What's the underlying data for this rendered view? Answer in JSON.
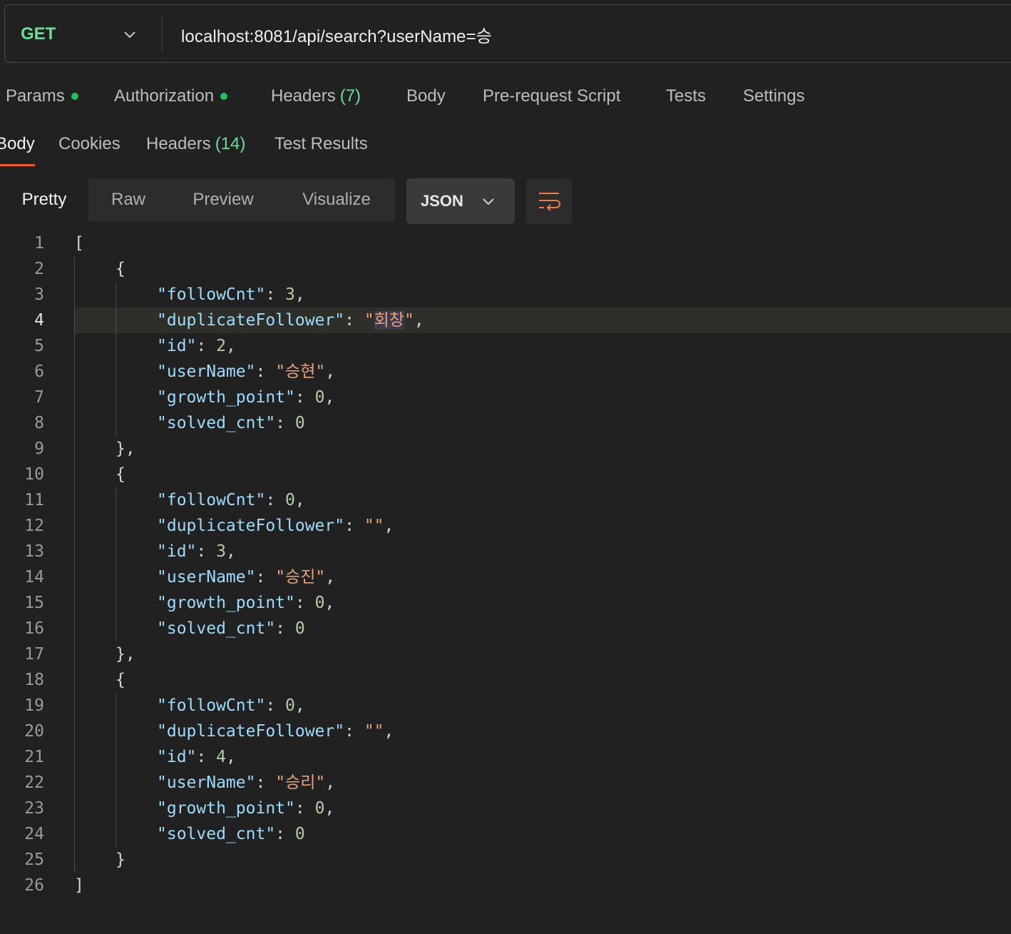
{
  "request": {
    "method": "GET",
    "url": "localhost:8081/api/search?userName=승"
  },
  "request_tabs": [
    {
      "label": "Params",
      "dot": true
    },
    {
      "label": "Authorization",
      "dot": true
    },
    {
      "label": "Headers",
      "count": "(7)"
    },
    {
      "label": "Body"
    },
    {
      "label": "Pre-request Script"
    },
    {
      "label": "Tests"
    },
    {
      "label": "Settings"
    }
  ],
  "response_tabs": [
    {
      "label": "Body",
      "count": ""
    },
    {
      "label": "Cookies",
      "count": ""
    },
    {
      "label": "Headers",
      "count": "(14)"
    },
    {
      "label": "Test Results",
      "count": ""
    }
  ],
  "active_response_tab": "Body",
  "view_modes": [
    "Pretty",
    "Raw",
    "Preview",
    "Visualize"
  ],
  "active_view_mode": "Pretty",
  "format": "JSON",
  "colors": {
    "method": "#6bdd9a",
    "accent": "#ef5b25",
    "status_dot": "#20c05c"
  },
  "icons": {
    "method_dropdown": "chevron-down-icon",
    "format_dropdown": "chevron-down-icon",
    "wrap": "wrap-lines-icon"
  },
  "editor": {
    "highlighted_line": 4,
    "selected_text": "회창",
    "lines": [
      {
        "n": "1",
        "indent": 0,
        "parts": [
          [
            "p",
            "["
          ]
        ]
      },
      {
        "n": "2",
        "indent": 1,
        "parts": [
          [
            "p",
            "{"
          ]
        ]
      },
      {
        "n": "3",
        "indent": 2,
        "parts": [
          [
            "k",
            "\"followCnt\""
          ],
          [
            "p",
            ": "
          ],
          [
            "n",
            "3"
          ],
          [
            "p",
            ","
          ]
        ]
      },
      {
        "n": "4",
        "indent": 2,
        "parts": [
          [
            "k",
            "\"duplicateFollower\""
          ],
          [
            "p",
            ": "
          ],
          [
            "s",
            "\""
          ],
          [
            "sel",
            "회창"
          ],
          [
            "s",
            "\""
          ],
          [
            "p",
            ","
          ]
        ]
      },
      {
        "n": "5",
        "indent": 2,
        "parts": [
          [
            "k",
            "\"id\""
          ],
          [
            "p",
            ": "
          ],
          [
            "n",
            "2"
          ],
          [
            "p",
            ","
          ]
        ]
      },
      {
        "n": "6",
        "indent": 2,
        "parts": [
          [
            "k",
            "\"userName\""
          ],
          [
            "p",
            ": "
          ],
          [
            "s",
            "\"승현\""
          ],
          [
            "p",
            ","
          ]
        ]
      },
      {
        "n": "7",
        "indent": 2,
        "parts": [
          [
            "k",
            "\"growth_point\""
          ],
          [
            "p",
            ": "
          ],
          [
            "n",
            "0"
          ],
          [
            "p",
            ","
          ]
        ]
      },
      {
        "n": "8",
        "indent": 2,
        "parts": [
          [
            "k",
            "\"solved_cnt\""
          ],
          [
            "p",
            ": "
          ],
          [
            "n",
            "0"
          ]
        ]
      },
      {
        "n": "9",
        "indent": 1,
        "parts": [
          [
            "p",
            "},"
          ]
        ]
      },
      {
        "n": "10",
        "indent": 1,
        "parts": [
          [
            "p",
            "{"
          ]
        ]
      },
      {
        "n": "11",
        "indent": 2,
        "parts": [
          [
            "k",
            "\"followCnt\""
          ],
          [
            "p",
            ": "
          ],
          [
            "n",
            "0"
          ],
          [
            "p",
            ","
          ]
        ]
      },
      {
        "n": "12",
        "indent": 2,
        "parts": [
          [
            "k",
            "\"duplicateFollower\""
          ],
          [
            "p",
            ": "
          ],
          [
            "s",
            "\"\""
          ],
          [
            "p",
            ","
          ]
        ]
      },
      {
        "n": "13",
        "indent": 2,
        "parts": [
          [
            "k",
            "\"id\""
          ],
          [
            "p",
            ": "
          ],
          [
            "n",
            "3"
          ],
          [
            "p",
            ","
          ]
        ]
      },
      {
        "n": "14",
        "indent": 2,
        "parts": [
          [
            "k",
            "\"userName\""
          ],
          [
            "p",
            ": "
          ],
          [
            "s",
            "\"승진\""
          ],
          [
            "p",
            ","
          ]
        ]
      },
      {
        "n": "15",
        "indent": 2,
        "parts": [
          [
            "k",
            "\"growth_point\""
          ],
          [
            "p",
            ": "
          ],
          [
            "n",
            "0"
          ],
          [
            "p",
            ","
          ]
        ]
      },
      {
        "n": "16",
        "indent": 2,
        "parts": [
          [
            "k",
            "\"solved_cnt\""
          ],
          [
            "p",
            ": "
          ],
          [
            "n",
            "0"
          ]
        ]
      },
      {
        "n": "17",
        "indent": 1,
        "parts": [
          [
            "p",
            "},"
          ]
        ]
      },
      {
        "n": "18",
        "indent": 1,
        "parts": [
          [
            "p",
            "{"
          ]
        ]
      },
      {
        "n": "19",
        "indent": 2,
        "parts": [
          [
            "k",
            "\"followCnt\""
          ],
          [
            "p",
            ": "
          ],
          [
            "n",
            "0"
          ],
          [
            "p",
            ","
          ]
        ]
      },
      {
        "n": "20",
        "indent": 2,
        "parts": [
          [
            "k",
            "\"duplicateFollower\""
          ],
          [
            "p",
            ": "
          ],
          [
            "s",
            "\"\""
          ],
          [
            "p",
            ","
          ]
        ]
      },
      {
        "n": "21",
        "indent": 2,
        "parts": [
          [
            "k",
            "\"id\""
          ],
          [
            "p",
            ": "
          ],
          [
            "n",
            "4"
          ],
          [
            "p",
            ","
          ]
        ]
      },
      {
        "n": "22",
        "indent": 2,
        "parts": [
          [
            "k",
            "\"userName\""
          ],
          [
            "p",
            ": "
          ],
          [
            "s",
            "\"승리\""
          ],
          [
            "p",
            ","
          ]
        ]
      },
      {
        "n": "23",
        "indent": 2,
        "parts": [
          [
            "k",
            "\"growth_point\""
          ],
          [
            "p",
            ": "
          ],
          [
            "n",
            "0"
          ],
          [
            "p",
            ","
          ]
        ]
      },
      {
        "n": "24",
        "indent": 2,
        "parts": [
          [
            "k",
            "\"solved_cnt\""
          ],
          [
            "p",
            ": "
          ],
          [
            "n",
            "0"
          ]
        ]
      },
      {
        "n": "25",
        "indent": 1,
        "parts": [
          [
            "p",
            "}"
          ]
        ]
      },
      {
        "n": "26",
        "indent": 0,
        "parts": [
          [
            "p",
            "]"
          ]
        ]
      }
    ]
  }
}
